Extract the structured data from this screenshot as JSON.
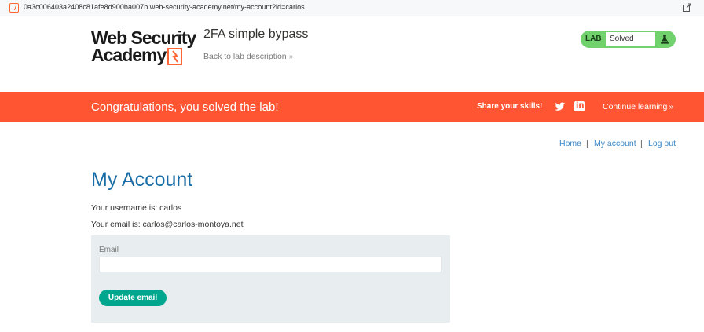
{
  "browser": {
    "url": "0a3c006403a2408c81afe8d900ba007b.web-security-academy.net/my-account?id=carlos"
  },
  "header": {
    "logo_line1": "Web Security",
    "logo_line2": "Academy",
    "lab_title": "2FA simple bypass",
    "back_link": "Back to lab description",
    "back_chevron": "»",
    "lab_status": {
      "label": "LAB",
      "status": "Solved",
      "status_color": "#70d16d"
    }
  },
  "banner": {
    "message": "Congratulations, you solved the lab!",
    "share_label": "Share your skills!",
    "continue_label": "Continue learning",
    "continue_chevron": "»",
    "background": "#ff5533"
  },
  "nav": {
    "home": "Home",
    "my_account": "My account",
    "log_out": "Log out",
    "separator": "|"
  },
  "main": {
    "title": "My Account",
    "username_line": "Your username is: carlos",
    "email_line": "Your email is: carlos@carlos-montoya.net",
    "form": {
      "email_label": "Email",
      "email_value": "",
      "submit_label": "Update email",
      "button_color": "#00a78e"
    }
  },
  "icons": [
    "site-favicon-icon",
    "open-external-icon",
    "logo-mark-icon",
    "flask-icon",
    "twitter-icon",
    "linkedin-icon"
  ]
}
